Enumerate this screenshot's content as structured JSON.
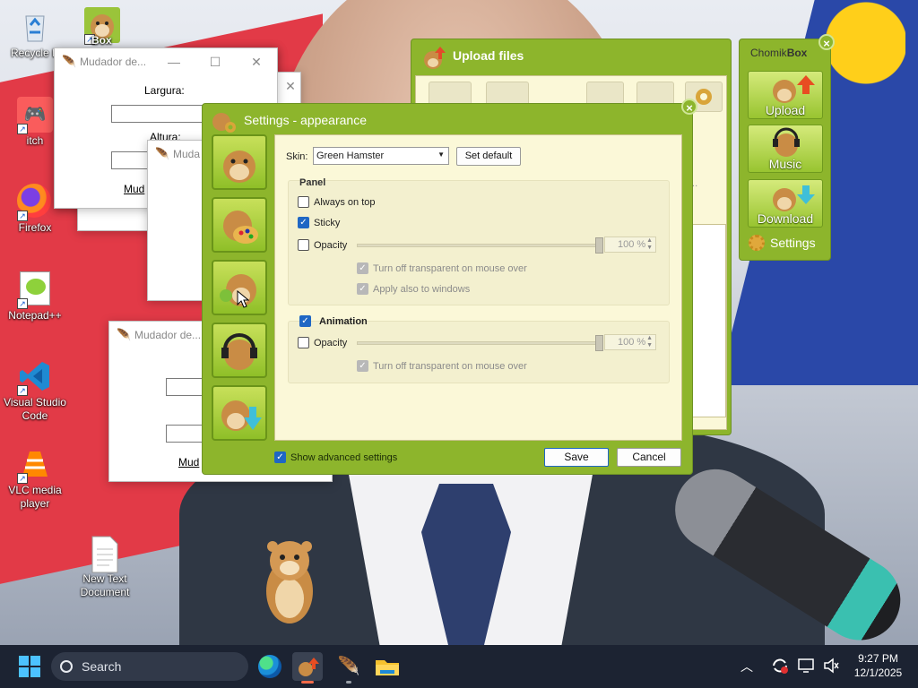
{
  "desktop": {
    "icons": [
      {
        "label": "Recycle Bin",
        "shown": "Recycle B"
      },
      {
        "label": "itch"
      },
      {
        "label": "Firefox"
      },
      {
        "label": "Notepad++"
      },
      {
        "label": "Visual Studio Code"
      },
      {
        "label": "VLC media player"
      },
      {
        "label": "New Text Document"
      }
    ],
    "box_icon_label": "Box"
  },
  "mudador_windows": [
    {
      "title": "Mudador de...",
      "largura_label": "Largura:",
      "altura_label": "Altura:",
      "link": "Mud"
    },
    {
      "title": "Muda"
    },
    {
      "title": "Mudador de...",
      "link": "Mud"
    }
  ],
  "upload_window": {
    "title": "Upload files",
    "ellipsis_button": "..."
  },
  "settings": {
    "title": "Settings - appearance",
    "skin_label": "Skin:",
    "skin_value": "Green Hamster",
    "set_default_button": "Set default",
    "panel_group": {
      "title": "Panel",
      "always_on_top": {
        "label": "Always on top",
        "checked": false
      },
      "sticky": {
        "label": "Sticky",
        "checked": true
      },
      "opacity": {
        "label": "Opacity",
        "checked": false,
        "value": "100 %"
      },
      "turn_off_transparent": {
        "label": "Turn off transparent on mouse over",
        "checked": true,
        "disabled": true
      },
      "apply_windows": {
        "label": "Apply also to windows",
        "checked": true,
        "disabled": true
      }
    },
    "animation_group": {
      "title": "Animation",
      "checked": true,
      "opacity": {
        "label": "Opacity",
        "checked": false,
        "value": "100 %"
      },
      "turn_off_transparent": {
        "label": "Turn off transparent on mouse over",
        "checked": true,
        "disabled": true
      }
    },
    "show_advanced": {
      "label": "Show advanced settings",
      "checked": true
    },
    "save_button": "Save",
    "cancel_button": "Cancel"
  },
  "chomikbox_panel": {
    "title_part1": "Chomik",
    "title_part2": "Box",
    "buttons": [
      "Upload",
      "Music",
      "Download"
    ],
    "settings_label": "Settings"
  },
  "taskbar": {
    "search_placeholder": "Search",
    "time": "9:27 PM",
    "date": "12/1/2025"
  },
  "colors": {
    "chomik_green": "#8db52c",
    "panel_cream": "#fbf8d8",
    "taskbar": "#1c2332",
    "checkbox_blue": "#1f67c4"
  }
}
